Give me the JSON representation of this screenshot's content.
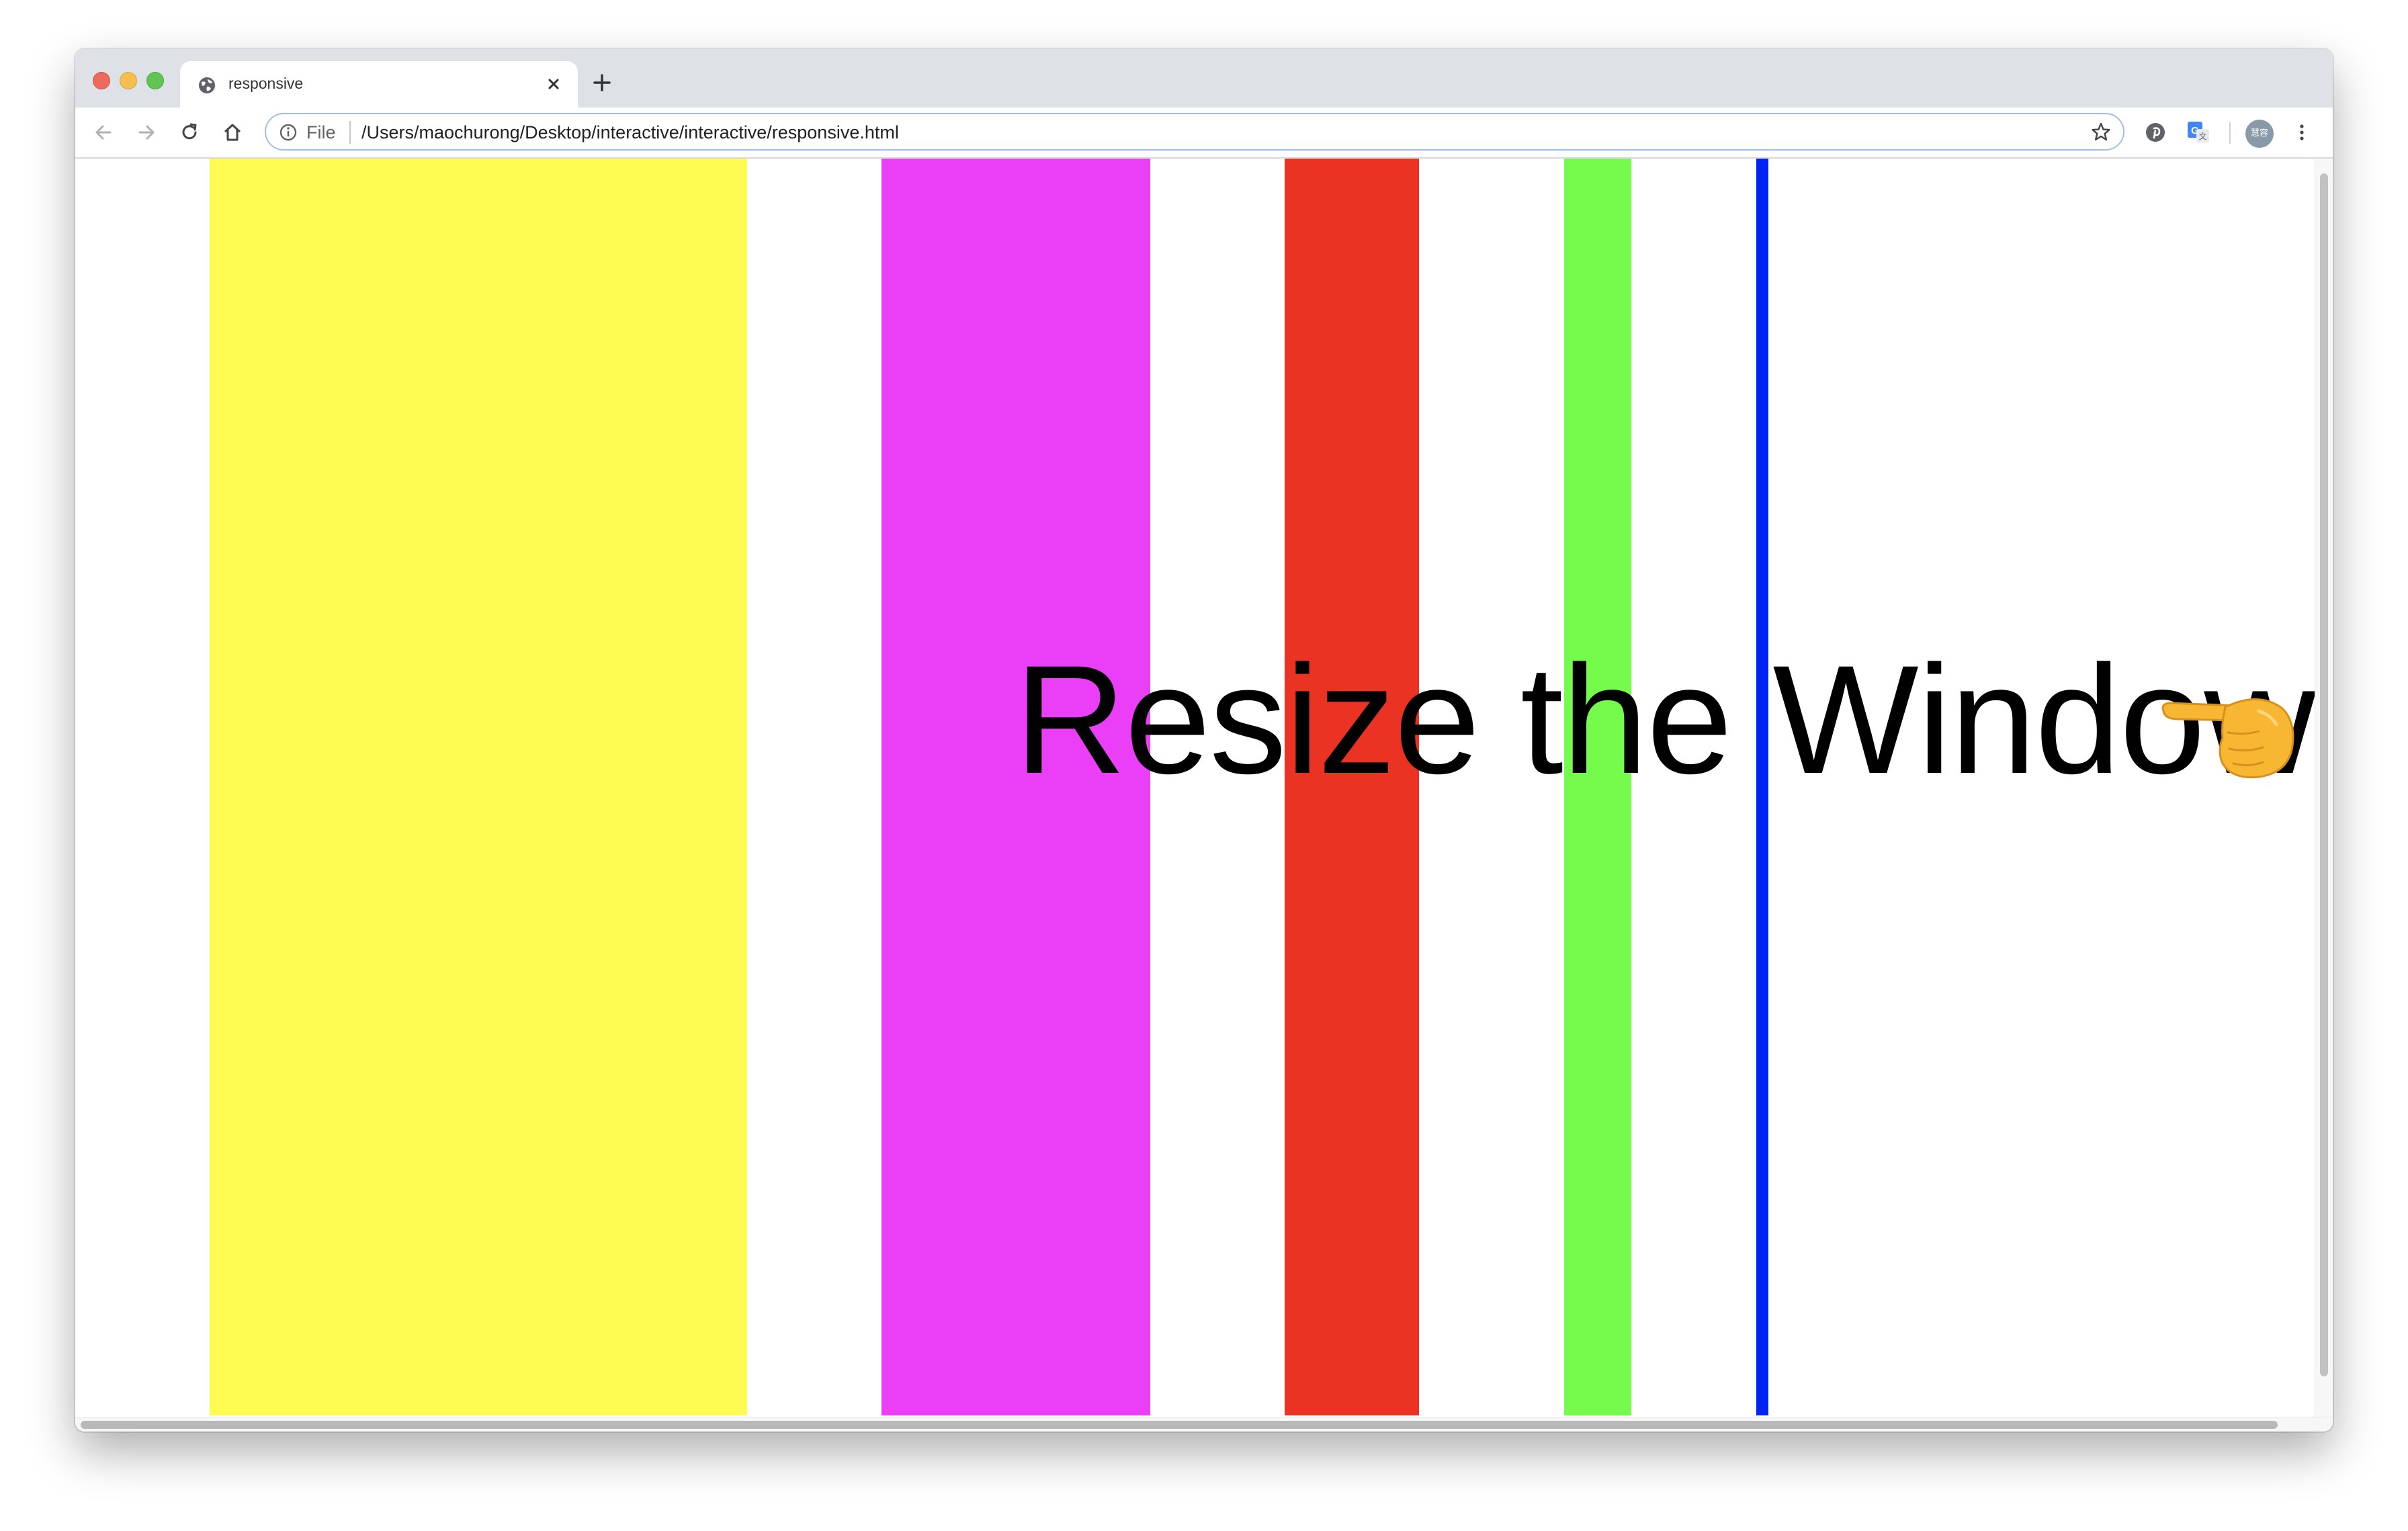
{
  "browser": {
    "tab": {
      "title": "responsive",
      "favicon": "globe-icon",
      "close_icon": "close-icon"
    },
    "new_tab_icon": "plus-icon",
    "nav": {
      "back": "arrow-left-icon",
      "forward": "arrow-right-icon",
      "reload": "reload-icon",
      "home": "home-icon"
    },
    "address_bar": {
      "scheme_label": "File",
      "url": "/Users/maochurong/Desktop/interactive/interactive/responsive.html",
      "info_icon": "info-icon",
      "bookmark_icon": "star-icon"
    },
    "extensions": [
      "pinterest-icon",
      "translate-icon"
    ],
    "profile_avatar_text": "慧容",
    "menu_icon": "kebab-menu-icon"
  },
  "page": {
    "headline": "Resize the Window",
    "pointer_emoji": "👈 backhand-index-pointing-right",
    "stripes": [
      {
        "color": "#fefb52"
      },
      {
        "color": "#ea3ff6"
      },
      {
        "color": "#ea3323"
      },
      {
        "color": "#75fb4c"
      },
      {
        "color": "#0024f4"
      }
    ]
  }
}
